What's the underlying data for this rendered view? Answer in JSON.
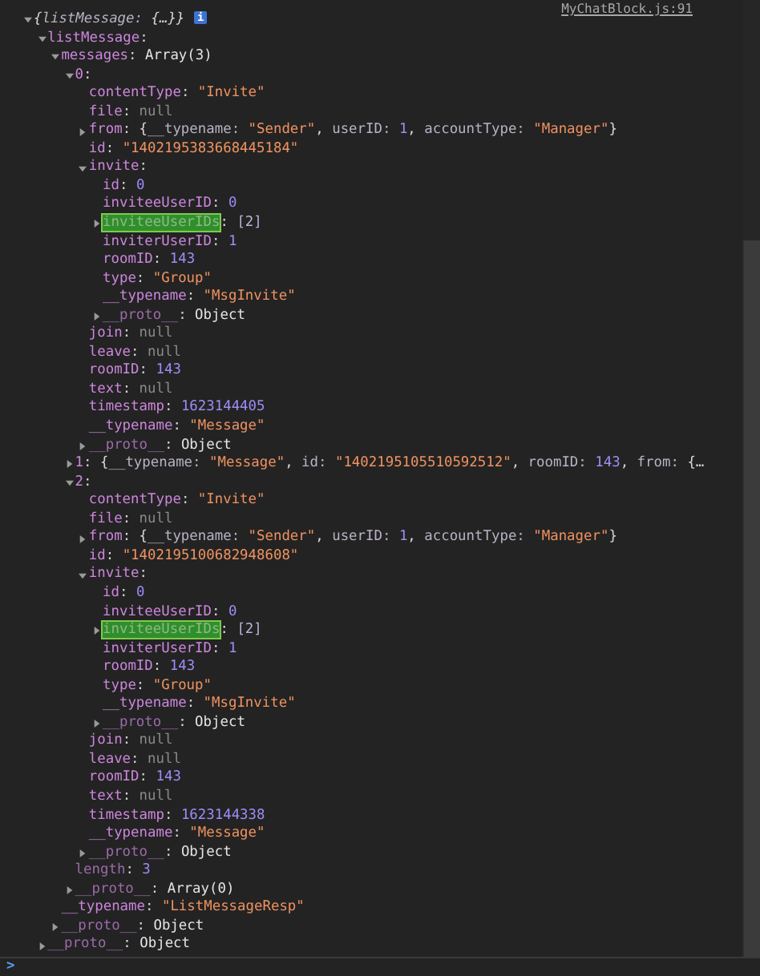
{
  "console": {
    "source_link": "MyChatBlock.js:91",
    "tree": {
      "kind": "summary",
      "expanded": true,
      "value": [
        {
          "kind": "punctuation",
          "text": "{"
        },
        {
          "kind": "key",
          "text": "listMessage: "
        },
        {
          "kind": "punctuation",
          "text": "{…}}"
        }
      ],
      "badge": "i",
      "children": [
        {
          "kind": "property",
          "key": "listMessage",
          "expanded": true,
          "value": [
            {
              "kind": "punctuation",
              "text": ":"
            }
          ],
          "children": [
            {
              "kind": "property",
              "key": "messages",
              "expanded": true,
              "value": [
                {
                  "kind": "punctuation",
                  "text": ": "
                },
                {
                  "kind": "object",
                  "text": "Array(3)"
                }
              ],
              "children": [
                {
                  "kind": "property",
                  "key": "0",
                  "expanded": true,
                  "value": [
                    {
                      "kind": "punctuation",
                      "text": ":"
                    }
                  ],
                  "children": [
                    {
                      "kind": "property",
                      "key": "contentType",
                      "value": [
                        {
                          "kind": "punctuation",
                          "text": ": "
                        },
                        {
                          "kind": "string",
                          "text": "\"Invite\""
                        }
                      ]
                    },
                    {
                      "kind": "property",
                      "key": "file",
                      "value": [
                        {
                          "kind": "punctuation",
                          "text": ": "
                        },
                        {
                          "kind": "null",
                          "text": "null"
                        }
                      ]
                    },
                    {
                      "kind": "property",
                      "key": "from",
                      "expanded": false,
                      "value": [
                        {
                          "kind": "punctuation",
                          "text": ": {"
                        },
                        {
                          "kind": "key",
                          "text": "__typename: "
                        },
                        {
                          "kind": "string",
                          "text": "\"Sender\""
                        },
                        {
                          "kind": "punctuation",
                          "text": ", "
                        },
                        {
                          "kind": "key",
                          "text": "userID: "
                        },
                        {
                          "kind": "number",
                          "text": "1"
                        },
                        {
                          "kind": "punctuation",
                          "text": ", "
                        },
                        {
                          "kind": "key",
                          "text": "accountType: "
                        },
                        {
                          "kind": "string",
                          "text": "\"Manager\""
                        },
                        {
                          "kind": "punctuation",
                          "text": "}"
                        }
                      ]
                    },
                    {
                      "kind": "property",
                      "key": "id",
                      "value": [
                        {
                          "kind": "punctuation",
                          "text": ": "
                        },
                        {
                          "kind": "string",
                          "text": "\"1402195383668445184\""
                        }
                      ]
                    },
                    {
                      "kind": "property",
                      "key": "invite",
                      "expanded": true,
                      "value": [
                        {
                          "kind": "punctuation",
                          "text": ":"
                        }
                      ],
                      "children": [
                        {
                          "kind": "property",
                          "key": "id",
                          "value": [
                            {
                              "kind": "punctuation",
                              "text": ": "
                            },
                            {
                              "kind": "number",
                              "text": "0"
                            }
                          ]
                        },
                        {
                          "kind": "property",
                          "key": "inviteeUserID",
                          "value": [
                            {
                              "kind": "punctuation",
                              "text": ": "
                            },
                            {
                              "kind": "number",
                              "text": "0"
                            }
                          ]
                        },
                        {
                          "kind": "property",
                          "key": "inviteeUserIDs",
                          "expanded": false,
                          "highlighted": true,
                          "value": [
                            {
                              "kind": "punctuation",
                              "text": ": "
                            },
                            {
                              "kind": "array",
                              "text": "[2]"
                            }
                          ]
                        },
                        {
                          "kind": "property",
                          "key": "inviterUserID",
                          "value": [
                            {
                              "kind": "punctuation",
                              "text": ": "
                            },
                            {
                              "kind": "number",
                              "text": "1"
                            }
                          ]
                        },
                        {
                          "kind": "property",
                          "key": "roomID",
                          "value": [
                            {
                              "kind": "punctuation",
                              "text": ": "
                            },
                            {
                              "kind": "number",
                              "text": "143"
                            }
                          ]
                        },
                        {
                          "kind": "property",
                          "key": "type",
                          "value": [
                            {
                              "kind": "punctuation",
                              "text": ": "
                            },
                            {
                              "kind": "string",
                              "text": "\"Group\""
                            }
                          ]
                        },
                        {
                          "kind": "property",
                          "key": "__typename",
                          "value": [
                            {
                              "kind": "punctuation",
                              "text": ": "
                            },
                            {
                              "kind": "string",
                              "text": "\"MsgInvite\""
                            }
                          ]
                        },
                        {
                          "kind": "internal",
                          "key": "__proto__",
                          "expanded": false,
                          "value": [
                            {
                              "kind": "punctuation",
                              "text": ": "
                            },
                            {
                              "kind": "object",
                              "text": "Object"
                            }
                          ]
                        }
                      ]
                    },
                    {
                      "kind": "property",
                      "key": "join",
                      "value": [
                        {
                          "kind": "punctuation",
                          "text": ": "
                        },
                        {
                          "kind": "null",
                          "text": "null"
                        }
                      ]
                    },
                    {
                      "kind": "property",
                      "key": "leave",
                      "value": [
                        {
                          "kind": "punctuation",
                          "text": ": "
                        },
                        {
                          "kind": "null",
                          "text": "null"
                        }
                      ]
                    },
                    {
                      "kind": "property",
                      "key": "roomID",
                      "value": [
                        {
                          "kind": "punctuation",
                          "text": ": "
                        },
                        {
                          "kind": "number",
                          "text": "143"
                        }
                      ]
                    },
                    {
                      "kind": "property",
                      "key": "text",
                      "value": [
                        {
                          "kind": "punctuation",
                          "text": ": "
                        },
                        {
                          "kind": "null",
                          "text": "null"
                        }
                      ]
                    },
                    {
                      "kind": "property",
                      "key": "timestamp",
                      "value": [
                        {
                          "kind": "punctuation",
                          "text": ": "
                        },
                        {
                          "kind": "number",
                          "text": "1623144405"
                        }
                      ]
                    },
                    {
                      "kind": "property",
                      "key": "__typename",
                      "value": [
                        {
                          "kind": "punctuation",
                          "text": ": "
                        },
                        {
                          "kind": "string",
                          "text": "\"Message\""
                        }
                      ]
                    },
                    {
                      "kind": "internal",
                      "key": "__proto__",
                      "expanded": false,
                      "value": [
                        {
                          "kind": "punctuation",
                          "text": ": "
                        },
                        {
                          "kind": "object",
                          "text": "Object"
                        }
                      ]
                    }
                  ]
                },
                {
                  "kind": "property",
                  "key": "1",
                  "expanded": false,
                  "value": [
                    {
                      "kind": "punctuation",
                      "text": ": {"
                    },
                    {
                      "kind": "key",
                      "text": "__typename: "
                    },
                    {
                      "kind": "string",
                      "text": "\"Message\""
                    },
                    {
                      "kind": "punctuation",
                      "text": ", "
                    },
                    {
                      "kind": "key",
                      "text": "id: "
                    },
                    {
                      "kind": "string",
                      "text": "\"1402195105510592512\""
                    },
                    {
                      "kind": "punctuation",
                      "text": ", "
                    },
                    {
                      "kind": "key",
                      "text": "roomID: "
                    },
                    {
                      "kind": "number",
                      "text": "143"
                    },
                    {
                      "kind": "punctuation",
                      "text": ", "
                    },
                    {
                      "kind": "key",
                      "text": "from: "
                    },
                    {
                      "kind": "punctuation",
                      "text": "{…"
                    }
                  ]
                },
                {
                  "kind": "property",
                  "key": "2",
                  "expanded": true,
                  "value": [
                    {
                      "kind": "punctuation",
                      "text": ":"
                    }
                  ],
                  "children": [
                    {
                      "kind": "property",
                      "key": "contentType",
                      "value": [
                        {
                          "kind": "punctuation",
                          "text": ": "
                        },
                        {
                          "kind": "string",
                          "text": "\"Invite\""
                        }
                      ]
                    },
                    {
                      "kind": "property",
                      "key": "file",
                      "value": [
                        {
                          "kind": "punctuation",
                          "text": ": "
                        },
                        {
                          "kind": "null",
                          "text": "null"
                        }
                      ]
                    },
                    {
                      "kind": "property",
                      "key": "from",
                      "expanded": false,
                      "value": [
                        {
                          "kind": "punctuation",
                          "text": ": {"
                        },
                        {
                          "kind": "key",
                          "text": "__typename: "
                        },
                        {
                          "kind": "string",
                          "text": "\"Sender\""
                        },
                        {
                          "kind": "punctuation",
                          "text": ", "
                        },
                        {
                          "kind": "key",
                          "text": "userID: "
                        },
                        {
                          "kind": "number",
                          "text": "1"
                        },
                        {
                          "kind": "punctuation",
                          "text": ", "
                        },
                        {
                          "kind": "key",
                          "text": "accountType: "
                        },
                        {
                          "kind": "string",
                          "text": "\"Manager\""
                        },
                        {
                          "kind": "punctuation",
                          "text": "}"
                        }
                      ]
                    },
                    {
                      "kind": "property",
                      "key": "id",
                      "value": [
                        {
                          "kind": "punctuation",
                          "text": ": "
                        },
                        {
                          "kind": "string",
                          "text": "\"1402195100682948608\""
                        }
                      ]
                    },
                    {
                      "kind": "property",
                      "key": "invite",
                      "expanded": true,
                      "value": [
                        {
                          "kind": "punctuation",
                          "text": ":"
                        }
                      ],
                      "children": [
                        {
                          "kind": "property",
                          "key": "id",
                          "value": [
                            {
                              "kind": "punctuation",
                              "text": ": "
                            },
                            {
                              "kind": "number",
                              "text": "0"
                            }
                          ]
                        },
                        {
                          "kind": "property",
                          "key": "inviteeUserID",
                          "value": [
                            {
                              "kind": "punctuation",
                              "text": ": "
                            },
                            {
                              "kind": "number",
                              "text": "0"
                            }
                          ]
                        },
                        {
                          "kind": "property",
                          "key": "inviteeUserIDs",
                          "expanded": false,
                          "highlighted": true,
                          "value": [
                            {
                              "kind": "punctuation",
                              "text": ": "
                            },
                            {
                              "kind": "array",
                              "text": "[2]"
                            }
                          ]
                        },
                        {
                          "kind": "property",
                          "key": "inviterUserID",
                          "value": [
                            {
                              "kind": "punctuation",
                              "text": ": "
                            },
                            {
                              "kind": "number",
                              "text": "1"
                            }
                          ]
                        },
                        {
                          "kind": "property",
                          "key": "roomID",
                          "value": [
                            {
                              "kind": "punctuation",
                              "text": ": "
                            },
                            {
                              "kind": "number",
                              "text": "143"
                            }
                          ]
                        },
                        {
                          "kind": "property",
                          "key": "type",
                          "value": [
                            {
                              "kind": "punctuation",
                              "text": ": "
                            },
                            {
                              "kind": "string",
                              "text": "\"Group\""
                            }
                          ]
                        },
                        {
                          "kind": "property",
                          "key": "__typename",
                          "value": [
                            {
                              "kind": "punctuation",
                              "text": ": "
                            },
                            {
                              "kind": "string",
                              "text": "\"MsgInvite\""
                            }
                          ]
                        },
                        {
                          "kind": "internal",
                          "key": "__proto__",
                          "expanded": false,
                          "value": [
                            {
                              "kind": "punctuation",
                              "text": ": "
                            },
                            {
                              "kind": "object",
                              "text": "Object"
                            }
                          ]
                        }
                      ]
                    },
                    {
                      "kind": "property",
                      "key": "join",
                      "value": [
                        {
                          "kind": "punctuation",
                          "text": ": "
                        },
                        {
                          "kind": "null",
                          "text": "null"
                        }
                      ]
                    },
                    {
                      "kind": "property",
                      "key": "leave",
                      "value": [
                        {
                          "kind": "punctuation",
                          "text": ": "
                        },
                        {
                          "kind": "null",
                          "text": "null"
                        }
                      ]
                    },
                    {
                      "kind": "property",
                      "key": "roomID",
                      "value": [
                        {
                          "kind": "punctuation",
                          "text": ": "
                        },
                        {
                          "kind": "number",
                          "text": "143"
                        }
                      ]
                    },
                    {
                      "kind": "property",
                      "key": "text",
                      "value": [
                        {
                          "kind": "punctuation",
                          "text": ": "
                        },
                        {
                          "kind": "null",
                          "text": "null"
                        }
                      ]
                    },
                    {
                      "kind": "property",
                      "key": "timestamp",
                      "value": [
                        {
                          "kind": "punctuation",
                          "text": ": "
                        },
                        {
                          "kind": "number",
                          "text": "1623144338"
                        }
                      ]
                    },
                    {
                      "kind": "property",
                      "key": "__typename",
                      "value": [
                        {
                          "kind": "punctuation",
                          "text": ": "
                        },
                        {
                          "kind": "string",
                          "text": "\"Message\""
                        }
                      ]
                    },
                    {
                      "kind": "internal",
                      "key": "__proto__",
                      "expanded": false,
                      "value": [
                        {
                          "kind": "punctuation",
                          "text": ": "
                        },
                        {
                          "kind": "object",
                          "text": "Object"
                        }
                      ]
                    }
                  ]
                },
                {
                  "kind": "internal",
                  "key": "length",
                  "value": [
                    {
                      "kind": "punctuation",
                      "text": ": "
                    },
                    {
                      "kind": "number",
                      "text": "3"
                    }
                  ]
                },
                {
                  "kind": "internal",
                  "key": "__proto__",
                  "expanded": false,
                  "value": [
                    {
                      "kind": "punctuation",
                      "text": ": "
                    },
                    {
                      "kind": "object",
                      "text": "Array(0)"
                    }
                  ]
                }
              ]
            },
            {
              "kind": "property",
              "key": "__typename",
              "value": [
                {
                  "kind": "punctuation",
                  "text": ": "
                },
                {
                  "kind": "string",
                  "text": "\"ListMessageResp\""
                }
              ]
            },
            {
              "kind": "internal",
              "key": "__proto__",
              "expanded": false,
              "value": [
                {
                  "kind": "punctuation",
                  "text": ": "
                },
                {
                  "kind": "object",
                  "text": "Object"
                }
              ]
            }
          ]
        },
        {
          "kind": "internal",
          "key": "__proto__",
          "expanded": false,
          "value": [
            {
              "kind": "punctuation",
              "text": ": "
            },
            {
              "kind": "object",
              "text": "Object"
            }
          ]
        }
      ]
    },
    "prompt": ">"
  }
}
